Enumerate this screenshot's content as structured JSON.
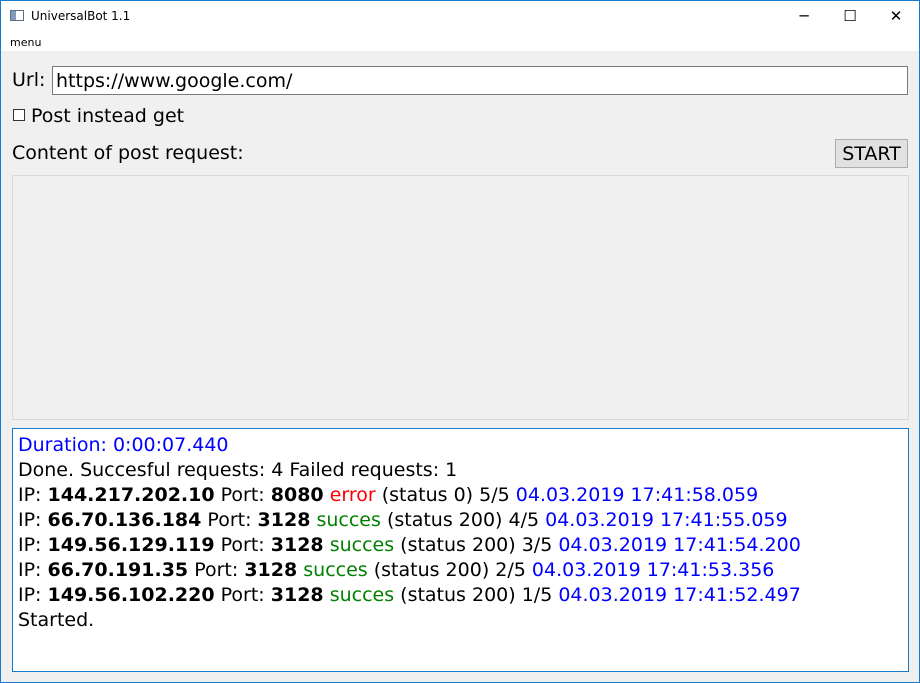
{
  "window": {
    "title": "UniversalBot 1.1",
    "controls": {
      "minimize": "─",
      "maximize": "☐",
      "close": "✕"
    }
  },
  "menu": {
    "label": "menu"
  },
  "form": {
    "url_label": "Url:",
    "url_value": "https://www.google.com/",
    "post_checkbox_label": "Post instead get",
    "post_checked": false,
    "content_label": "Content of post request:",
    "start_label": "START",
    "post_content": ""
  },
  "log": {
    "duration_text": "Duration: 0:00:07.440",
    "summary": "Done. Succesful requests: 4 Failed requests: 1",
    "entries": [
      {
        "ip_label": "IP: ",
        "ip": "144.217.202.10",
        "port_label": " Port: ",
        "port": "8080",
        "result": "error",
        "status": "(status 0) 5/5",
        "time": "04.03.2019 17:41:58.059"
      },
      {
        "ip_label": "IP: ",
        "ip": "66.70.136.184",
        "port_label": " Port: ",
        "port": "3128",
        "result": "succes",
        "status": "(status 200) 4/5",
        "time": "04.03.2019 17:41:55.059"
      },
      {
        "ip_label": "IP: ",
        "ip": "149.56.129.119",
        "port_label": " Port: ",
        "port": "3128",
        "result": "succes",
        "status": "(status 200) 3/5",
        "time": "04.03.2019 17:41:54.200"
      },
      {
        "ip_label": "IP: ",
        "ip": "66.70.191.35",
        "port_label": " Port: ",
        "port": "3128",
        "result": "succes",
        "status": "(status 200) 2/5",
        "time": "04.03.2019 17:41:53.356"
      },
      {
        "ip_label": "IP: ",
        "ip": "149.56.102.220",
        "port_label": " Port: ",
        "port": "3128",
        "result": "succes",
        "status": "(status 200) 1/5",
        "time": "04.03.2019 17:41:52.497"
      }
    ],
    "started": "Started."
  },
  "colors": {
    "timestamp": "#0000ff",
    "error": "#ff0000",
    "success": "#008000",
    "window_border": "#1979ca"
  }
}
